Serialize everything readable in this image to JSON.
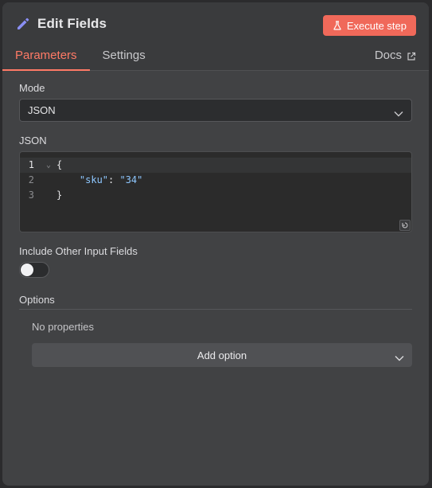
{
  "header": {
    "title": "Edit Fields",
    "execute_label": "Execute step",
    "tabs": [
      {
        "label": "Parameters",
        "active": true
      },
      {
        "label": "Settings",
        "active": false
      }
    ],
    "docs_label": "Docs"
  },
  "mode": {
    "label": "Mode",
    "value": "JSON"
  },
  "json_field": {
    "label": "JSON",
    "lines": [
      {
        "num": "1",
        "text": "{"
      },
      {
        "num": "2",
        "key": "\"sku\"",
        "sep": ": ",
        "value": "\"34\""
      },
      {
        "num": "3",
        "text": "}"
      }
    ]
  },
  "include_other": {
    "label": "Include Other Input Fields",
    "enabled": false
  },
  "options": {
    "label": "Options",
    "empty_text": "No properties",
    "add_label": "Add option"
  },
  "colors": {
    "accent": "#ff7a66",
    "execute_button": "#f0695a",
    "panel_bg": "#414244"
  },
  "icons": {
    "title": "pencil-icon",
    "execute": "flask-icon",
    "docs": "external-link-icon",
    "dropdown": "chevron-down-icon",
    "fold": "fold-chevron-icon",
    "editor_resize": "resize-icon"
  }
}
